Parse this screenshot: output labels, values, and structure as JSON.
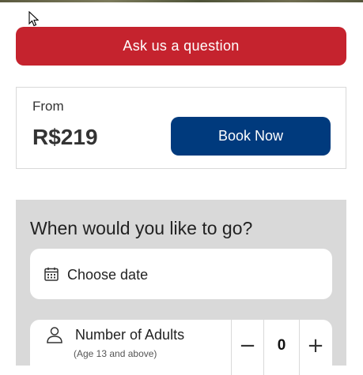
{
  "ask": {
    "label": "Ask us a question"
  },
  "pricing": {
    "from_label": "From",
    "price": "R$219",
    "book_label": "Book Now"
  },
  "booking": {
    "heading": "When would you like to go?",
    "date": {
      "label": "Choose date",
      "icon": "calendar-icon"
    },
    "adults": {
      "label": "Number of Adults",
      "sublabel": "(Age 13 and above)",
      "icon": "person-icon",
      "decrement": "−",
      "increment": "+",
      "value": "0"
    }
  },
  "colors": {
    "ask_button": "#c5232e",
    "book_button": "#003a7d",
    "panel": "#d9d9d9"
  }
}
